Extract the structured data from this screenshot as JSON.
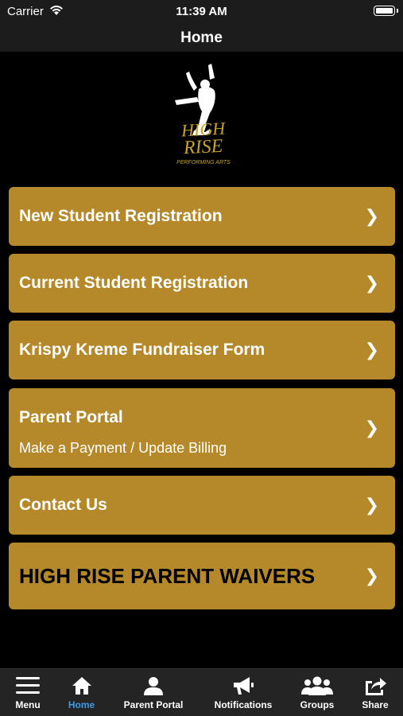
{
  "status": {
    "carrier": "Carrier",
    "time": "11:39 AM"
  },
  "nav": {
    "title": "Home"
  },
  "logo": {
    "line1": "HIGH",
    "line2": "RISE",
    "line3": "PERFORMING ARTS"
  },
  "menu": [
    {
      "label": "New Student Registration"
    },
    {
      "label": "Current Student Registration"
    },
    {
      "label": "Krispy Kreme Fundraiser Form"
    },
    {
      "label": "Parent Portal",
      "sublabel": "Make a Payment / Update Billing"
    },
    {
      "label": "Contact Us"
    },
    {
      "label": "HIGH RISE PARENT WAIVERS"
    }
  ],
  "chevron": "❯",
  "tabs": [
    {
      "label": "Menu",
      "icon": "hamburger-icon"
    },
    {
      "label": "Home",
      "icon": "home-icon",
      "active": true
    },
    {
      "label": "Parent Portal",
      "icon": "person-icon"
    },
    {
      "label": "Notifications",
      "icon": "megaphone-icon"
    },
    {
      "label": "Groups",
      "icon": "group-icon"
    },
    {
      "label": "Share",
      "icon": "share-icon"
    }
  ],
  "colors": {
    "button": "#b58829",
    "active_tab": "#3a9ce9",
    "bar": "#1c1c1c",
    "logo_gold": "#c9a227"
  }
}
